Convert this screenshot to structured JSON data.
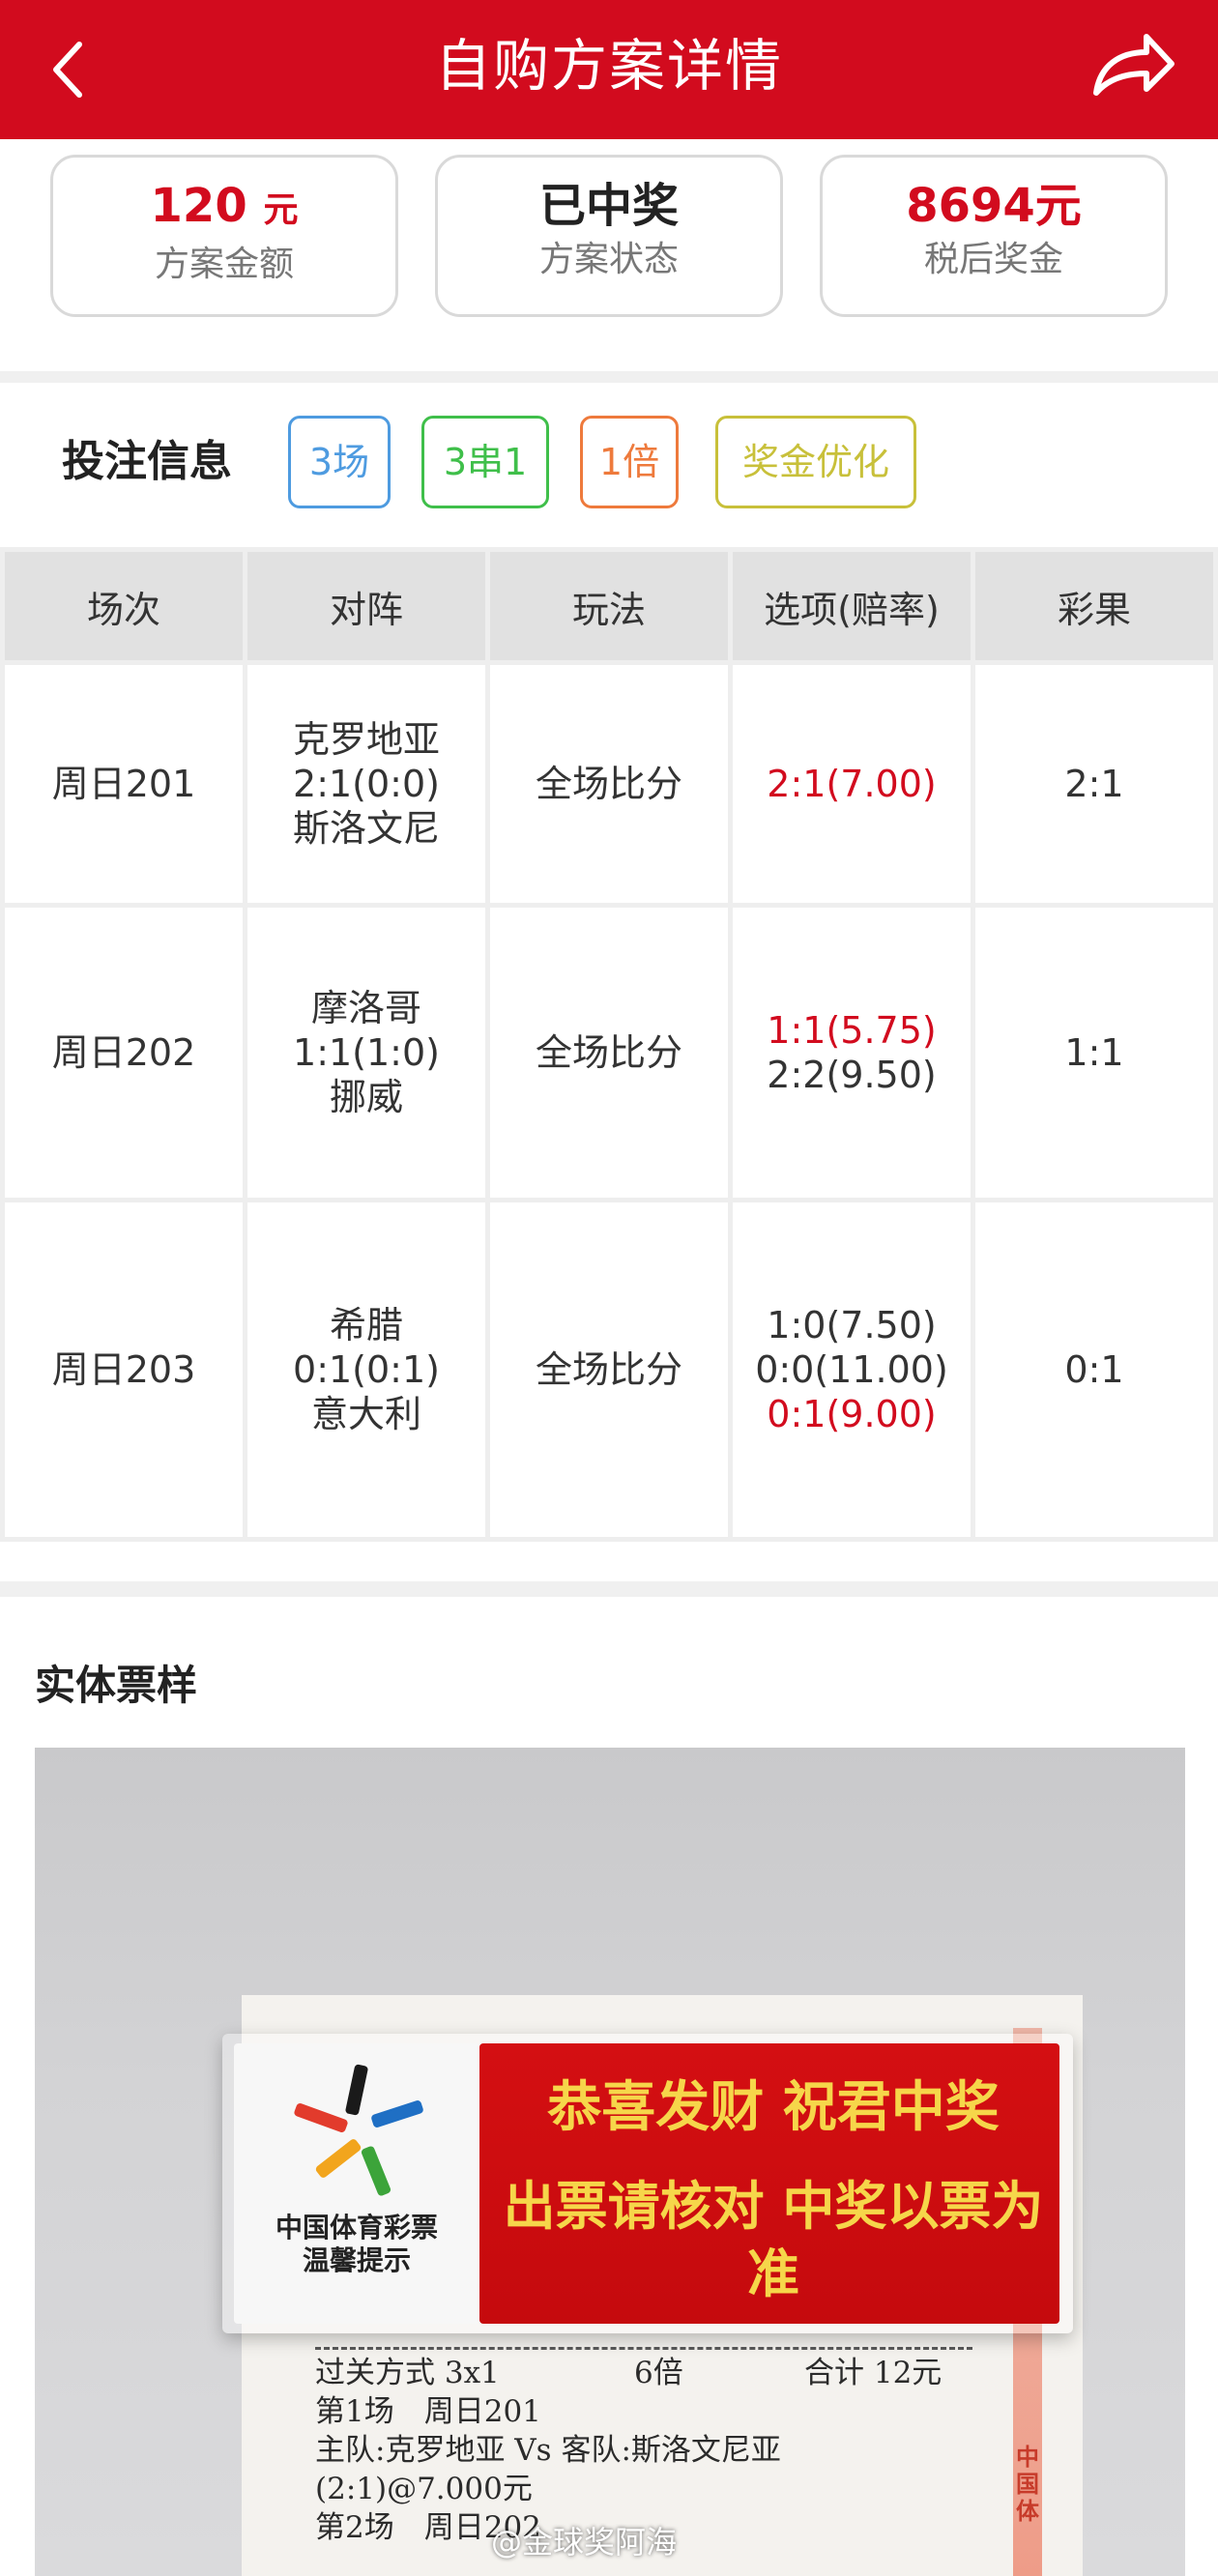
{
  "header": {
    "title": "自购方案详情",
    "back_icon": "chevron-left-icon",
    "share_icon": "share-arrow-icon"
  },
  "summary": {
    "amount": {
      "value": "120",
      "unit": "元",
      "label": "方案金额"
    },
    "status": {
      "value": "已中奖",
      "label": "方案状态"
    },
    "prize": {
      "value": "8694元",
      "label": "税后奖金"
    }
  },
  "bet_info": {
    "title": "投注信息",
    "tags": [
      "3场",
      "3串1",
      "1倍",
      "奖金优化"
    ]
  },
  "table": {
    "headers": [
      "场次",
      "对阵",
      "玩法",
      "选项(赔率)",
      "彩果"
    ],
    "rows": [
      {
        "match_no": "周日201",
        "home": "克罗地亚",
        "score": "2:1(0:0)",
        "away": "斯洛文尼",
        "play": "全场比分",
        "options": [
          {
            "text": "2:1(7.00)",
            "hit": true
          }
        ],
        "result": "2:1"
      },
      {
        "match_no": "周日202",
        "home": "摩洛哥",
        "score": "1:1(1:0)",
        "away": "挪威",
        "play": "全场比分",
        "options": [
          {
            "text": "1:1(5.75)",
            "hit": true
          },
          {
            "text": "2:2(9.50)",
            "hit": false
          }
        ],
        "result": "1:1"
      },
      {
        "match_no": "周日203",
        "home": "希腊",
        "score": "0:1(0:1)",
        "away": "意大利",
        "play": "全场比分",
        "options": [
          {
            "text": "1:0(7.50)",
            "hit": false
          },
          {
            "text": "0:0(11.00)",
            "hit": false
          },
          {
            "text": "0:1(9.00)",
            "hit": true
          }
        ],
        "result": "0:1"
      }
    ]
  },
  "ticket": {
    "title": "实体票样",
    "plaque": {
      "logo_line1": "中国体育彩票",
      "logo_line2": "温馨提示",
      "slogan1": "恭喜发财 祝君中奖",
      "slogan2": "出票请核对 中奖以票为准"
    },
    "lines": {
      "pass_mode": "过关方式 3x1",
      "multiple": "6倍",
      "total": "合计 12元",
      "match1": "第1场　周日201",
      "teams1": "主队:克罗地亚 Vs 客队:斯洛文尼亚",
      "pick1": "(2:1)@7.000元",
      "match2": "第2场　周日202"
    },
    "stripe_text": "中国体",
    "watermark": "@金球奖阿海"
  },
  "colors": {
    "brand_red": "#d20b1e",
    "hit_red": "#d20b1e"
  }
}
